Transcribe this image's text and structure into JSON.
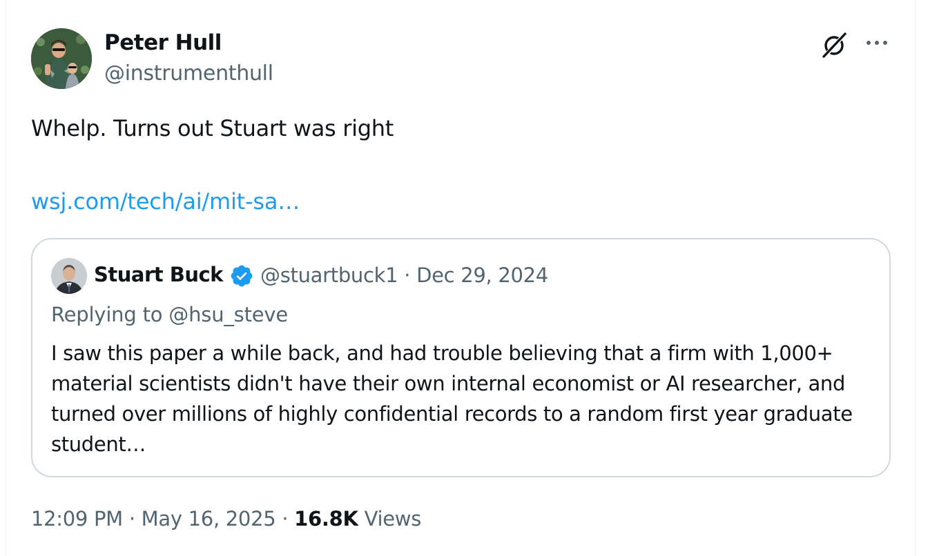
{
  "tweet": {
    "author": {
      "name": "Peter Hull",
      "handle": "@instrumenthull"
    },
    "text": "Whelp. Turns out Stuart was right",
    "link": "wsj.com/tech/ai/mit-sa…",
    "quoted": {
      "name": "Stuart Buck",
      "handle": "@stuartbuck1",
      "separator": "·",
      "date": "Dec 29, 2024",
      "replying_to": "Replying to @hsu_steve",
      "body": "I saw this paper a while back, and had trouble believing that a firm with 1,000+ material scientists didn't have their own internal economist or AI researcher, and turned over millions of highly confidential records to a random first year graduate student…"
    },
    "footer": {
      "time": "12:09 PM",
      "separator": "·",
      "date": "May 16, 2025",
      "views_count": "16.8K",
      "views_label": "Views"
    }
  },
  "icons": {
    "grok": "grok-icon",
    "more": "more-icon",
    "verified": "verified-badge-icon"
  },
  "colors": {
    "link": "#1d9bf0",
    "secondary_text": "#536471",
    "primary_text": "#0f1419",
    "border": "#cfd9de",
    "verified": "#1d9bf0"
  }
}
